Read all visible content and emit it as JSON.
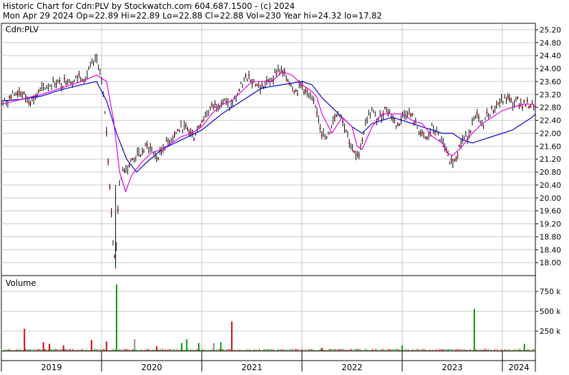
{
  "header": {
    "line1": "Historic Chart for Cdn:PLV by Stockwatch.com 604.687.1500 - (c) 2024",
    "line2": "Mon Apr 29 2024  Op=22.89  Hi=22.89  Lo=22.88  Cl=22.88  Vol=230  Year hi=24.32  lo=17.82"
  },
  "colors": {
    "background": "#ffffff",
    "grid": "#c8c8c8",
    "frame": "#000000",
    "price_bar": "#000000",
    "price_down_mark": "#cc0000",
    "ma_short": "#e000e0",
    "ma_long": "#0000cc",
    "volume_up": "#009900",
    "volume_down": "#cc0000",
    "volume_flat": "#888888"
  },
  "chart_data": [
    {
      "type": "line",
      "panel": "price",
      "label": "Cdn:PLV",
      "ylim": [
        17.6,
        25.4
      ],
      "yticks": [
        18.0,
        18.4,
        18.8,
        19.2,
        19.6,
        20.0,
        20.4,
        20.8,
        21.2,
        21.6,
        22.0,
        22.4,
        22.8,
        23.2,
        23.6,
        24.0,
        24.4,
        24.8,
        25.2
      ],
      "ytick_labels": [
        "18.00",
        "18.40",
        "18.80",
        "19.20",
        "19.60",
        "20.00",
        "20.40",
        "20.80",
        "21.20",
        "21.60",
        "22.00",
        "22.40",
        "22.80",
        "23.20",
        "23.60",
        "24.00",
        "24.40",
        "24.80",
        "25.20"
      ],
      "x_range": [
        2019.0,
        2024.33
      ],
      "grid": true,
      "series": [
        {
          "role": "close",
          "x": [
            2019.0,
            2019.06,
            2019.12,
            2019.18,
            2019.24,
            2019.3,
            2019.36,
            2019.42,
            2019.48,
            2019.54,
            2019.6,
            2019.66,
            2019.72,
            2019.78,
            2019.84,
            2019.9,
            2019.96,
            2020.0,
            2020.04,
            2020.08,
            2020.12,
            2020.14,
            2020.16,
            2020.18,
            2020.2,
            2020.22,
            2020.24,
            2020.27,
            2020.31,
            2020.35,
            2020.4,
            2020.45,
            2020.5,
            2020.56,
            2020.62,
            2020.68,
            2020.74,
            2020.8,
            2020.86,
            2020.92,
            2020.98,
            2021.04,
            2021.1,
            2021.16,
            2021.22,
            2021.28,
            2021.34,
            2021.4,
            2021.46,
            2021.52,
            2021.58,
            2021.64,
            2021.7,
            2021.76,
            2021.82,
            2021.88,
            2021.94,
            2022.0,
            2022.05,
            2022.1,
            2022.15,
            2022.2,
            2022.25,
            2022.3,
            2022.35,
            2022.4,
            2022.45,
            2022.5,
            2022.55,
            2022.6,
            2022.65,
            2022.7,
            2022.75,
            2022.8,
            2022.85,
            2022.9,
            2022.95,
            2023.0,
            2023.05,
            2023.1,
            2023.15,
            2023.2,
            2023.25,
            2023.3,
            2023.35,
            2023.4,
            2023.45,
            2023.5,
            2023.55,
            2023.6,
            2023.65,
            2023.7,
            2023.75,
            2023.8,
            2023.85,
            2023.9,
            2023.95,
            2024.0,
            2024.05,
            2024.1,
            2024.15,
            2024.2,
            2024.25,
            2024.3,
            2024.33
          ],
          "values": [
            22.9,
            23.0,
            23.2,
            23.3,
            23.1,
            23.0,
            23.2,
            23.4,
            23.5,
            23.6,
            23.5,
            23.7,
            23.6,
            23.8,
            23.7,
            24.1,
            24.3,
            23.6,
            22.5,
            20.5,
            18.4,
            17.9,
            19.6,
            20.4,
            20.8,
            21.0,
            20.9,
            21.0,
            21.2,
            21.3,
            21.4,
            21.6,
            21.5,
            21.2,
            21.6,
            21.8,
            22.0,
            22.2,
            22.1,
            21.9,
            22.3,
            22.6,
            22.8,
            22.9,
            23.0,
            22.8,
            23.1,
            23.5,
            23.8,
            23.6,
            23.4,
            23.5,
            23.7,
            24.0,
            23.8,
            23.6,
            23.3,
            23.5,
            23.2,
            23.0,
            22.7,
            22.0,
            21.8,
            22.3,
            22.7,
            22.5,
            22.0,
            21.5,
            21.2,
            21.8,
            22.5,
            22.7,
            22.4,
            22.6,
            22.8,
            22.5,
            22.2,
            22.5,
            22.7,
            22.5,
            22.2,
            21.9,
            21.8,
            22.2,
            22.0,
            21.7,
            21.3,
            21.1,
            21.4,
            21.8,
            21.9,
            22.3,
            22.5,
            22.2,
            22.6,
            22.7,
            22.9,
            23.0,
            23.1,
            22.9,
            23.0,
            22.9,
            22.9,
            22.88,
            22.88
          ]
        },
        {
          "role": "moving_average_short",
          "x": [
            2019.0,
            2019.2,
            2019.4,
            2019.6,
            2019.8,
            2019.95,
            2020.05,
            2020.12,
            2020.18,
            2020.24,
            2020.3,
            2020.4,
            2020.5,
            2020.6,
            2020.7,
            2020.8,
            2020.9,
            2021.0,
            2021.1,
            2021.2,
            2021.3,
            2021.4,
            2021.5,
            2021.6,
            2021.7,
            2021.8,
            2021.9,
            2022.0,
            2022.1,
            2022.15,
            2022.2,
            2022.3,
            2022.4,
            2022.5,
            2022.55,
            2022.6,
            2022.7,
            2022.8,
            2022.9,
            2023.0,
            2023.1,
            2023.2,
            2023.3,
            2023.4,
            2023.45,
            2023.5,
            2023.6,
            2023.7,
            2023.8,
            2023.9,
            2024.0,
            2024.1,
            2024.2,
            2024.3,
            2024.33
          ],
          "values": [
            22.9,
            23.05,
            23.2,
            23.4,
            23.6,
            23.8,
            23.6,
            22.4,
            20.8,
            20.2,
            20.7,
            21.1,
            21.4,
            21.5,
            21.7,
            21.9,
            22.0,
            22.2,
            22.6,
            22.9,
            23.0,
            23.3,
            23.6,
            23.6,
            23.6,
            23.9,
            23.8,
            23.5,
            23.3,
            23.1,
            22.6,
            22.0,
            22.5,
            22.2,
            21.6,
            21.5,
            22.2,
            22.6,
            22.6,
            22.6,
            22.4,
            22.3,
            21.9,
            21.7,
            21.4,
            21.3,
            21.6,
            22.0,
            22.3,
            22.5,
            22.7,
            22.8,
            22.9,
            22.9,
            22.8
          ]
        },
        {
          "role": "moving_average_long",
          "x": [
            2019.0,
            2019.2,
            2019.4,
            2019.6,
            2019.8,
            2019.95,
            2020.05,
            2020.15,
            2020.25,
            2020.35,
            2020.45,
            2020.6,
            2020.8,
            2021.0,
            2021.2,
            2021.4,
            2021.6,
            2021.8,
            2022.0,
            2022.1,
            2022.2,
            2022.3,
            2022.4,
            2022.5,
            2022.6,
            2022.7,
            2022.8,
            2022.9,
            2023.0,
            2023.1,
            2023.2,
            2023.3,
            2023.4,
            2023.5,
            2023.6,
            2023.7,
            2023.8,
            2023.9,
            2024.0,
            2024.1,
            2024.2,
            2024.3,
            2024.33
          ],
          "values": [
            23.0,
            23.05,
            23.15,
            23.35,
            23.5,
            23.6,
            23.0,
            22.0,
            21.2,
            20.8,
            21.1,
            21.5,
            21.8,
            22.1,
            22.6,
            23.0,
            23.4,
            23.5,
            23.6,
            23.5,
            23.1,
            22.8,
            22.5,
            22.2,
            22.0,
            22.3,
            22.4,
            22.5,
            22.4,
            22.3,
            22.2,
            22.1,
            22.0,
            22.0,
            21.8,
            21.7,
            21.8,
            21.9,
            22.0,
            22.1,
            22.3,
            22.5,
            22.6
          ]
        }
      ]
    },
    {
      "type": "bar",
      "panel": "volume",
      "label": "Volume",
      "ylim": [
        0,
        950000
      ],
      "yticks": [
        250000,
        500000,
        750000
      ],
      "ytick_labels": [
        "250 k",
        "500 k",
        "750 k"
      ],
      "x_range": [
        2019.0,
        2024.33
      ],
      "spikes": [
        {
          "x": 2019.23,
          "value": 280000,
          "dir": "down"
        },
        {
          "x": 2019.42,
          "value": 110000,
          "dir": "down"
        },
        {
          "x": 2019.48,
          "value": 90000,
          "dir": "down"
        },
        {
          "x": 2019.62,
          "value": 70000,
          "dir": "down"
        },
        {
          "x": 2019.9,
          "value": 140000,
          "dir": "down"
        },
        {
          "x": 2020.05,
          "value": 120000,
          "dir": "down"
        },
        {
          "x": 2020.15,
          "value": 840000,
          "dir": "up"
        },
        {
          "x": 2020.33,
          "value": 150000,
          "dir": "flat"
        },
        {
          "x": 2020.55,
          "value": 60000,
          "dir": "down"
        },
        {
          "x": 2020.8,
          "value": 100000,
          "dir": "up"
        },
        {
          "x": 2020.85,
          "value": 150000,
          "dir": "up"
        },
        {
          "x": 2020.97,
          "value": 100000,
          "dir": "up"
        },
        {
          "x": 2021.12,
          "value": 100000,
          "dir": "flat"
        },
        {
          "x": 2021.19,
          "value": 110000,
          "dir": "up"
        },
        {
          "x": 2021.3,
          "value": 370000,
          "dir": "down"
        },
        {
          "x": 2022.2,
          "value": 40000,
          "dir": "down"
        },
        {
          "x": 2023.0,
          "value": 70000,
          "dir": "up"
        },
        {
          "x": 2023.72,
          "value": 530000,
          "dir": "up"
        },
        {
          "x": 2024.22,
          "value": 90000,
          "dir": "up"
        }
      ]
    }
  ],
  "xaxis": {
    "labels": [
      {
        "text": "2019",
        "x": 2019.5
      },
      {
        "text": "2020",
        "x": 2020.5
      },
      {
        "text": "2021",
        "x": 2021.5
      },
      {
        "text": "2022",
        "x": 2022.5
      },
      {
        "text": "2023",
        "x": 2023.5
      },
      {
        "text": "2024",
        "x": 2024.165
      }
    ],
    "boundaries": [
      2020.0,
      2021.0,
      2022.0,
      2023.0,
      2024.0
    ]
  }
}
